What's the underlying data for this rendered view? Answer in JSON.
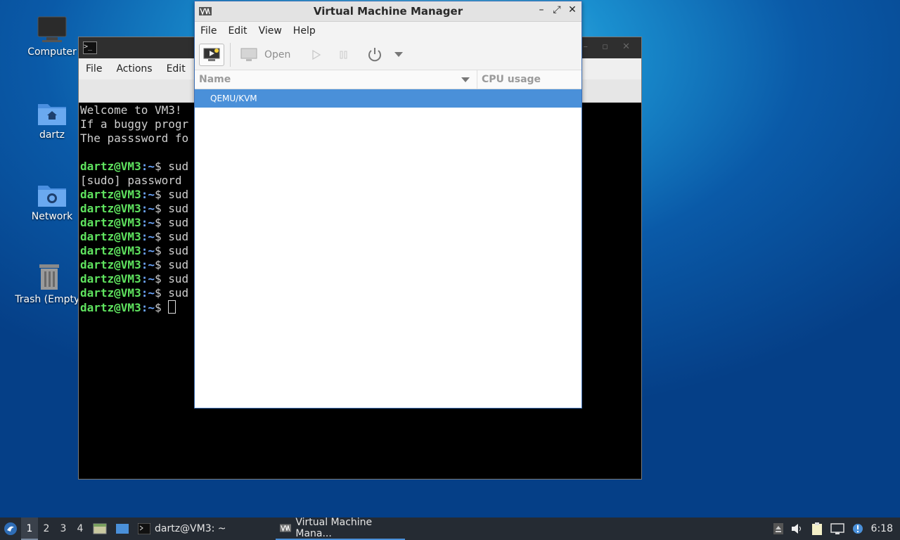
{
  "desktop": {
    "icons": [
      {
        "label": "Computer"
      },
      {
        "label": "dartz"
      },
      {
        "label": "Network"
      },
      {
        "label": "Trash (Empty)"
      }
    ]
  },
  "terminal": {
    "menu": [
      "File",
      "Actions",
      "Edit"
    ],
    "lines": [
      {
        "type": "text",
        "text": "Welcome to VM3!"
      },
      {
        "type": "text",
        "text": "If a buggy progr"
      },
      {
        "type": "text",
        "text": "The passsword fo"
      },
      {
        "type": "blank",
        "text": ""
      },
      {
        "type": "prompt",
        "user": "dartz@VM3",
        "path": ":~",
        "cmd": "$ sud"
      },
      {
        "type": "text",
        "text": "[sudo] password "
      },
      {
        "type": "prompt",
        "user": "dartz@VM3",
        "path": ":~",
        "cmd": "$ sud"
      },
      {
        "type": "prompt",
        "user": "dartz@VM3",
        "path": ":~",
        "cmd": "$ sud"
      },
      {
        "type": "prompt",
        "user": "dartz@VM3",
        "path": ":~",
        "cmd": "$ sud"
      },
      {
        "type": "prompt",
        "user": "dartz@VM3",
        "path": ":~",
        "cmd": "$ sud"
      },
      {
        "type": "prompt",
        "user": "dartz@VM3",
        "path": ":~",
        "cmd": "$ sud"
      },
      {
        "type": "prompt",
        "user": "dartz@VM3",
        "path": ":~",
        "cmd": "$ sud"
      },
      {
        "type": "prompt",
        "user": "dartz@VM3",
        "path": ":~",
        "cmd": "$ sud"
      },
      {
        "type": "prompt",
        "user": "dartz@VM3",
        "path": ":~",
        "cmd": "$ sud"
      },
      {
        "type": "prompt-cursor",
        "user": "dartz@VM3",
        "path": ":~",
        "cmd": "$ "
      }
    ]
  },
  "vmm": {
    "title": "Virtual Machine Manager",
    "menu": [
      "File",
      "Edit",
      "View",
      "Help"
    ],
    "toolbar": {
      "open_label": "Open"
    },
    "columns": {
      "name": "Name",
      "cpu": "CPU usage"
    },
    "rows": [
      {
        "name": "QEMU/KVM"
      }
    ]
  },
  "taskbar": {
    "workspaces": [
      "1",
      "2",
      "3",
      "4"
    ],
    "active_workspace": "1",
    "tasks": [
      {
        "label": "dartz@VM3: ~"
      },
      {
        "label": "Virtual Machine Mana..."
      }
    ],
    "clock": "6:18"
  }
}
